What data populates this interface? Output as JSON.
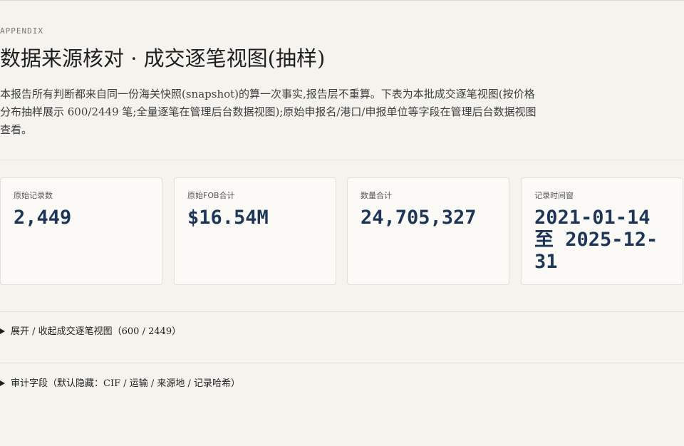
{
  "header": {
    "eyebrow": "APPENDIX",
    "title": "数据来源核对 · 成交逐笔视图(抽样)",
    "description": "本报告所有判断都来自同一份海关快照(snapshot)的算一次事实,报告层不重算。下表为本批成交逐笔视图(按价格分布抽样展示 600/2449 笔;全量逐笔在管理后台数据视图);原始申报名/港口/申报单位等字段在管理后台数据视图查看。"
  },
  "stats": [
    {
      "label": "原始记录数",
      "value": "2,449"
    },
    {
      "label": "原始FOB合计",
      "value": "$16.54M"
    },
    {
      "label": "数量合计",
      "value": "24,705,327"
    },
    {
      "label": "记录时间窗",
      "value": "2021-01-14 至 2025-12-31"
    }
  ],
  "details": [
    {
      "summary": "展开 / 收起成交逐笔视图（600 / 2449）"
    },
    {
      "summary": "审计字段（默认隐藏：CIF / 运输 / 来源地 / 记录哈希）"
    }
  ]
}
